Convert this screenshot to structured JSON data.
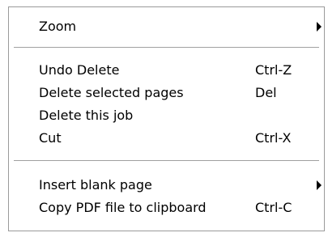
{
  "menu": {
    "zoom": {
      "label": "Zoom",
      "submenu_icon": "submenu-arrow-icon"
    },
    "undo_delete": {
      "label": "Undo Delete",
      "shortcut": "Ctrl-Z"
    },
    "delete_selected_pages": {
      "label": "Delete selected pages",
      "shortcut": "Del"
    },
    "delete_this_job": {
      "label": "Delete this job"
    },
    "cut": {
      "label": "Cut",
      "shortcut": "Ctrl-X"
    },
    "insert_blank_page": {
      "label": "Insert blank page",
      "submenu_icon": "submenu-arrow-icon"
    },
    "copy_pdf": {
      "label": "Copy PDF file to clipboard",
      "shortcut": "Ctrl-C"
    }
  }
}
